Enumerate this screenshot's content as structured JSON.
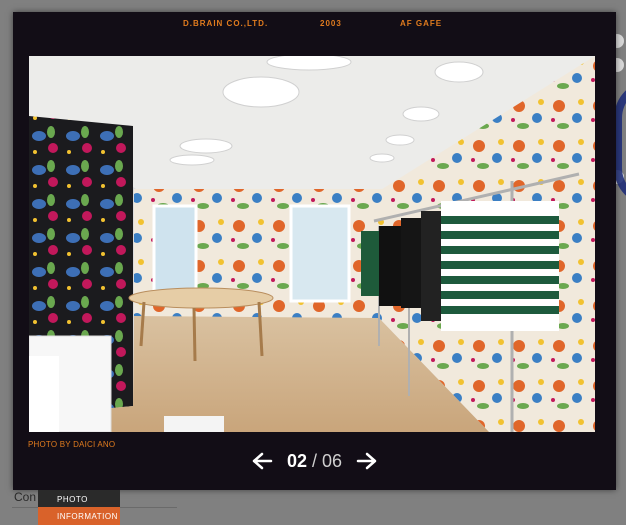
{
  "header": {
    "company": "D.BRAIN CO.,LTD.",
    "year": "2003",
    "project": "AF GAFE"
  },
  "photo": {
    "credit": "PHOTO BY DAICI ANO",
    "alt": "Retail interior with patterned wallpaper, wooden table and striped knit sweaters on a rack"
  },
  "pager": {
    "current": "02",
    "separator": "/",
    "total": "06"
  },
  "page_behind": {
    "text_fragment": "Con"
  },
  "tabs": {
    "photo": "PHOTO",
    "information": "INFORMATION"
  },
  "colors": {
    "overlay_bg": "#120d16",
    "accent_orange": "#e07b1e",
    "tab_active": "#d9622a"
  }
}
